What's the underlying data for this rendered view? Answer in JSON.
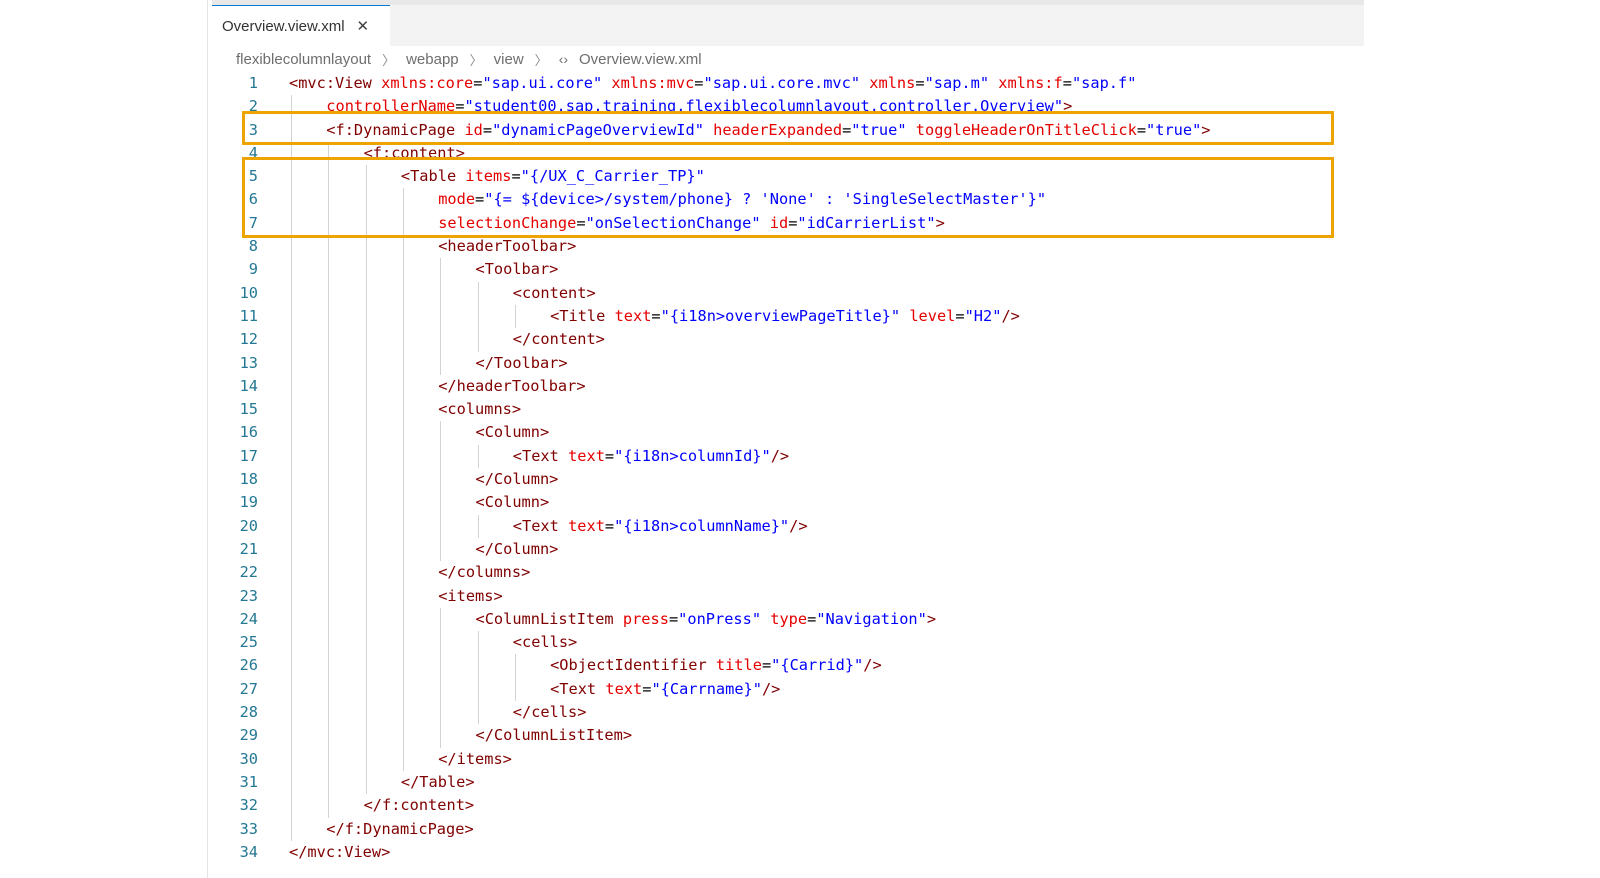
{
  "tab": {
    "label": "Overview.view.xml",
    "close_icon": "close-icon"
  },
  "breadcrumb": [
    "flexiblecolumnlayout",
    "webapp",
    "view",
    "Overview.view.xml"
  ],
  "colors": {
    "highlight": "#eea400",
    "tag": "#800000",
    "attr": "#e50000",
    "value": "#0000ff",
    "line_number": "#237893"
  },
  "code": {
    "lines": [
      {
        "n": "1",
        "indent": 0,
        "tokens": [
          [
            "t",
            "<mvc:View"
          ],
          [
            "p",
            " "
          ],
          [
            "a",
            "xmlns:core"
          ],
          [
            "p",
            "="
          ],
          [
            "v",
            "\"sap.ui.core\""
          ],
          [
            "p",
            " "
          ],
          [
            "a",
            "xmlns:mvc"
          ],
          [
            "p",
            "="
          ],
          [
            "v",
            "\"sap.ui.core.mvc\""
          ],
          [
            "p",
            " "
          ],
          [
            "a",
            "xmlns"
          ],
          [
            "p",
            "="
          ],
          [
            "v",
            "\"sap.m\""
          ],
          [
            "p",
            " "
          ],
          [
            "a",
            "xmlns:f"
          ],
          [
            "p",
            "="
          ],
          [
            "v",
            "\"sap.f\""
          ]
        ]
      },
      {
        "n": "2",
        "indent": 1,
        "tokens": [
          [
            "a",
            "controllerName"
          ],
          [
            "p",
            "="
          ],
          [
            "v",
            "\"student00.sap.training.flexiblecolumnlayout.controller.Overview\""
          ],
          [
            "t",
            ">"
          ]
        ]
      },
      {
        "n": "3",
        "indent": 1,
        "tokens": [
          [
            "t",
            "<f:DynamicPage"
          ],
          [
            "p",
            " "
          ],
          [
            "a",
            "id"
          ],
          [
            "p",
            "="
          ],
          [
            "v",
            "\"dynamicPageOverviewId\""
          ],
          [
            "p",
            " "
          ],
          [
            "a",
            "headerExpanded"
          ],
          [
            "p",
            "="
          ],
          [
            "v",
            "\"true\""
          ],
          [
            "p",
            " "
          ],
          [
            "a",
            "toggleHeaderOnTitleClick"
          ],
          [
            "p",
            "="
          ],
          [
            "v",
            "\"true\""
          ],
          [
            "t",
            ">"
          ]
        ]
      },
      {
        "n": "4",
        "indent": 2,
        "tokens": [
          [
            "t",
            "<f:content>"
          ]
        ]
      },
      {
        "n": "5",
        "indent": 3,
        "tokens": [
          [
            "t",
            "<Table"
          ],
          [
            "p",
            " "
          ],
          [
            "a",
            "items"
          ],
          [
            "p",
            "="
          ],
          [
            "v",
            "\"{/UX_C_Carrier_TP}\""
          ]
        ]
      },
      {
        "n": "6",
        "indent": 4,
        "tokens": [
          [
            "a",
            "mode"
          ],
          [
            "p",
            "="
          ],
          [
            "v",
            "\"{= ${device>/system/phone} ? 'None' : 'SingleSelectMaster'}\""
          ]
        ]
      },
      {
        "n": "7",
        "indent": 4,
        "tokens": [
          [
            "a",
            "selectionChange"
          ],
          [
            "p",
            "="
          ],
          [
            "v",
            "\"onSelectionChange\""
          ],
          [
            "p",
            " "
          ],
          [
            "a",
            "id"
          ],
          [
            "p",
            "="
          ],
          [
            "v",
            "\"idCarrierList\""
          ],
          [
            "t",
            ">"
          ]
        ]
      },
      {
        "n": "8",
        "indent": 4,
        "tokens": [
          [
            "t",
            "<headerToolbar>"
          ]
        ]
      },
      {
        "n": "9",
        "indent": 5,
        "tokens": [
          [
            "t",
            "<Toolbar>"
          ]
        ]
      },
      {
        "n": "10",
        "indent": 6,
        "tokens": [
          [
            "t",
            "<content>"
          ]
        ]
      },
      {
        "n": "11",
        "indent": 7,
        "tokens": [
          [
            "t",
            "<Title"
          ],
          [
            "p",
            " "
          ],
          [
            "a",
            "text"
          ],
          [
            "p",
            "="
          ],
          [
            "v",
            "\"{i18n>overviewPageTitle}\""
          ],
          [
            "p",
            " "
          ],
          [
            "a",
            "level"
          ],
          [
            "p",
            "="
          ],
          [
            "v",
            "\"H2\""
          ],
          [
            "t",
            "/>"
          ]
        ]
      },
      {
        "n": "12",
        "indent": 6,
        "tokens": [
          [
            "t",
            "</content>"
          ]
        ]
      },
      {
        "n": "13",
        "indent": 5,
        "tokens": [
          [
            "t",
            "</Toolbar>"
          ]
        ]
      },
      {
        "n": "14",
        "indent": 4,
        "tokens": [
          [
            "t",
            "</headerToolbar>"
          ]
        ]
      },
      {
        "n": "15",
        "indent": 4,
        "tokens": [
          [
            "t",
            "<columns>"
          ]
        ]
      },
      {
        "n": "16",
        "indent": 5,
        "tokens": [
          [
            "t",
            "<Column>"
          ]
        ]
      },
      {
        "n": "17",
        "indent": 6,
        "tokens": [
          [
            "t",
            "<Text"
          ],
          [
            "p",
            " "
          ],
          [
            "a",
            "text"
          ],
          [
            "p",
            "="
          ],
          [
            "v",
            "\"{i18n>columnId}\""
          ],
          [
            "t",
            "/>"
          ]
        ]
      },
      {
        "n": "18",
        "indent": 5,
        "tokens": [
          [
            "t",
            "</Column>"
          ]
        ]
      },
      {
        "n": "19",
        "indent": 5,
        "tokens": [
          [
            "t",
            "<Column>"
          ]
        ]
      },
      {
        "n": "20",
        "indent": 6,
        "tokens": [
          [
            "t",
            "<Text"
          ],
          [
            "p",
            " "
          ],
          [
            "a",
            "text"
          ],
          [
            "p",
            "="
          ],
          [
            "v",
            "\"{i18n>columnName}\""
          ],
          [
            "t",
            "/>"
          ]
        ]
      },
      {
        "n": "21",
        "indent": 5,
        "tokens": [
          [
            "t",
            "</Column>"
          ]
        ]
      },
      {
        "n": "22",
        "indent": 4,
        "tokens": [
          [
            "t",
            "</columns>"
          ]
        ]
      },
      {
        "n": "23",
        "indent": 4,
        "tokens": [
          [
            "t",
            "<items>"
          ]
        ]
      },
      {
        "n": "24",
        "indent": 5,
        "tokens": [
          [
            "t",
            "<ColumnListItem"
          ],
          [
            "p",
            " "
          ],
          [
            "a",
            "press"
          ],
          [
            "p",
            "="
          ],
          [
            "v",
            "\"onPress\""
          ],
          [
            "p",
            " "
          ],
          [
            "a",
            "type"
          ],
          [
            "p",
            "="
          ],
          [
            "v",
            "\"Navigation\""
          ],
          [
            "t",
            ">"
          ]
        ]
      },
      {
        "n": "25",
        "indent": 6,
        "tokens": [
          [
            "t",
            "<cells>"
          ]
        ]
      },
      {
        "n": "26",
        "indent": 7,
        "tokens": [
          [
            "t",
            "<ObjectIdentifier"
          ],
          [
            "p",
            " "
          ],
          [
            "a",
            "title"
          ],
          [
            "p",
            "="
          ],
          [
            "v",
            "\"{Carrid}\""
          ],
          [
            "t",
            "/>"
          ]
        ]
      },
      {
        "n": "27",
        "indent": 7,
        "tokens": [
          [
            "t",
            "<Text"
          ],
          [
            "p",
            " "
          ],
          [
            "a",
            "text"
          ],
          [
            "p",
            "="
          ],
          [
            "v",
            "\"{Carrname}\""
          ],
          [
            "t",
            "/>"
          ]
        ]
      },
      {
        "n": "28",
        "indent": 6,
        "tokens": [
          [
            "t",
            "</cells>"
          ]
        ]
      },
      {
        "n": "29",
        "indent": 5,
        "tokens": [
          [
            "t",
            "</ColumnListItem>"
          ]
        ]
      },
      {
        "n": "30",
        "indent": 4,
        "tokens": [
          [
            "t",
            "</items>"
          ]
        ]
      },
      {
        "n": "31",
        "indent": 3,
        "tokens": [
          [
            "t",
            "</Table>"
          ]
        ]
      },
      {
        "n": "32",
        "indent": 2,
        "tokens": [
          [
            "t",
            "</f:content>"
          ]
        ]
      },
      {
        "n": "33",
        "indent": 1,
        "tokens": [
          [
            "t",
            "</f:DynamicPage>"
          ]
        ]
      },
      {
        "n": "34",
        "indent": 0,
        "tokens": [
          [
            "t",
            "</mvc:View>"
          ]
        ]
      }
    ],
    "highlights": [
      {
        "from": "3",
        "to": "3"
      },
      {
        "from": "5",
        "to": "7"
      }
    ]
  }
}
